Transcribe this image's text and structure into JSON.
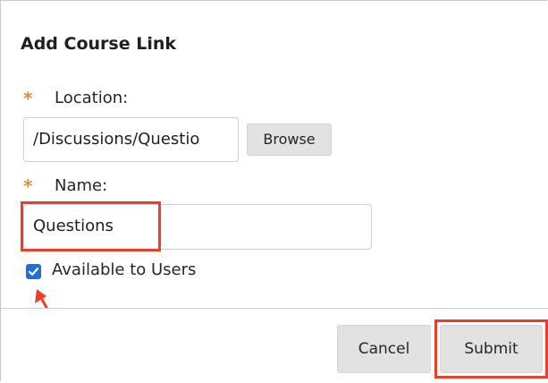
{
  "dialog": {
    "title": "Add Course Link"
  },
  "location": {
    "required_marker": "*",
    "label": "Location:",
    "value": "/Discussions/Questio",
    "browse_label": "Browse"
  },
  "name": {
    "required_marker": "*",
    "label": "Name:",
    "value": "Questions"
  },
  "availability": {
    "checked": true,
    "label": "Available to Users"
  },
  "footer": {
    "cancel_label": "Cancel",
    "submit_label": "Submit"
  },
  "colors": {
    "required_star": "#e88a2e",
    "highlight": "#e8402a",
    "checkbox": "#1f6fd6"
  },
  "icons": {
    "checkbox_check": "check-icon",
    "annotation_arrow": "arrow-icon"
  }
}
